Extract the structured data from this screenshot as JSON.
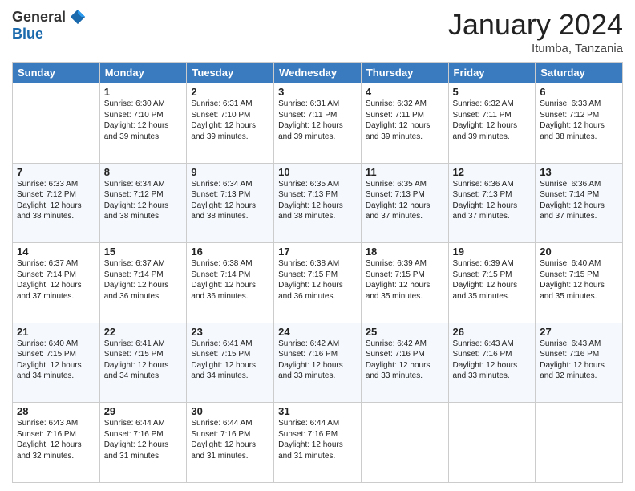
{
  "logo": {
    "general": "General",
    "blue": "Blue"
  },
  "title": "January 2024",
  "subtitle": "Itumba, Tanzania",
  "columns": [
    "Sunday",
    "Monday",
    "Tuesday",
    "Wednesday",
    "Thursday",
    "Friday",
    "Saturday"
  ],
  "weeks": [
    [
      {
        "day": "",
        "info": ""
      },
      {
        "day": "1",
        "info": "Sunrise: 6:30 AM\nSunset: 7:10 PM\nDaylight: 12 hours and 39 minutes."
      },
      {
        "day": "2",
        "info": "Sunrise: 6:31 AM\nSunset: 7:10 PM\nDaylight: 12 hours and 39 minutes."
      },
      {
        "day": "3",
        "info": "Sunrise: 6:31 AM\nSunset: 7:11 PM\nDaylight: 12 hours and 39 minutes."
      },
      {
        "day": "4",
        "info": "Sunrise: 6:32 AM\nSunset: 7:11 PM\nDaylight: 12 hours and 39 minutes."
      },
      {
        "day": "5",
        "info": "Sunrise: 6:32 AM\nSunset: 7:11 PM\nDaylight: 12 hours and 39 minutes."
      },
      {
        "day": "6",
        "info": "Sunrise: 6:33 AM\nSunset: 7:12 PM\nDaylight: 12 hours and 38 minutes."
      }
    ],
    [
      {
        "day": "7",
        "info": "Sunrise: 6:33 AM\nSunset: 7:12 PM\nDaylight: 12 hours and 38 minutes."
      },
      {
        "day": "8",
        "info": "Sunrise: 6:34 AM\nSunset: 7:12 PM\nDaylight: 12 hours and 38 minutes."
      },
      {
        "day": "9",
        "info": "Sunrise: 6:34 AM\nSunset: 7:13 PM\nDaylight: 12 hours and 38 minutes."
      },
      {
        "day": "10",
        "info": "Sunrise: 6:35 AM\nSunset: 7:13 PM\nDaylight: 12 hours and 38 minutes."
      },
      {
        "day": "11",
        "info": "Sunrise: 6:35 AM\nSunset: 7:13 PM\nDaylight: 12 hours and 37 minutes."
      },
      {
        "day": "12",
        "info": "Sunrise: 6:36 AM\nSunset: 7:13 PM\nDaylight: 12 hours and 37 minutes."
      },
      {
        "day": "13",
        "info": "Sunrise: 6:36 AM\nSunset: 7:14 PM\nDaylight: 12 hours and 37 minutes."
      }
    ],
    [
      {
        "day": "14",
        "info": "Sunrise: 6:37 AM\nSunset: 7:14 PM\nDaylight: 12 hours and 37 minutes."
      },
      {
        "day": "15",
        "info": "Sunrise: 6:37 AM\nSunset: 7:14 PM\nDaylight: 12 hours and 36 minutes."
      },
      {
        "day": "16",
        "info": "Sunrise: 6:38 AM\nSunset: 7:14 PM\nDaylight: 12 hours and 36 minutes."
      },
      {
        "day": "17",
        "info": "Sunrise: 6:38 AM\nSunset: 7:15 PM\nDaylight: 12 hours and 36 minutes."
      },
      {
        "day": "18",
        "info": "Sunrise: 6:39 AM\nSunset: 7:15 PM\nDaylight: 12 hours and 35 minutes."
      },
      {
        "day": "19",
        "info": "Sunrise: 6:39 AM\nSunset: 7:15 PM\nDaylight: 12 hours and 35 minutes."
      },
      {
        "day": "20",
        "info": "Sunrise: 6:40 AM\nSunset: 7:15 PM\nDaylight: 12 hours and 35 minutes."
      }
    ],
    [
      {
        "day": "21",
        "info": "Sunrise: 6:40 AM\nSunset: 7:15 PM\nDaylight: 12 hours and 34 minutes."
      },
      {
        "day": "22",
        "info": "Sunrise: 6:41 AM\nSunset: 7:15 PM\nDaylight: 12 hours and 34 minutes."
      },
      {
        "day": "23",
        "info": "Sunrise: 6:41 AM\nSunset: 7:15 PM\nDaylight: 12 hours and 34 minutes."
      },
      {
        "day": "24",
        "info": "Sunrise: 6:42 AM\nSunset: 7:16 PM\nDaylight: 12 hours and 33 minutes."
      },
      {
        "day": "25",
        "info": "Sunrise: 6:42 AM\nSunset: 7:16 PM\nDaylight: 12 hours and 33 minutes."
      },
      {
        "day": "26",
        "info": "Sunrise: 6:43 AM\nSunset: 7:16 PM\nDaylight: 12 hours and 33 minutes."
      },
      {
        "day": "27",
        "info": "Sunrise: 6:43 AM\nSunset: 7:16 PM\nDaylight: 12 hours and 32 minutes."
      }
    ],
    [
      {
        "day": "28",
        "info": "Sunrise: 6:43 AM\nSunset: 7:16 PM\nDaylight: 12 hours and 32 minutes."
      },
      {
        "day": "29",
        "info": "Sunrise: 6:44 AM\nSunset: 7:16 PM\nDaylight: 12 hours and 31 minutes."
      },
      {
        "day": "30",
        "info": "Sunrise: 6:44 AM\nSunset: 7:16 PM\nDaylight: 12 hours and 31 minutes."
      },
      {
        "day": "31",
        "info": "Sunrise: 6:44 AM\nSunset: 7:16 PM\nDaylight: 12 hours and 31 minutes."
      },
      {
        "day": "",
        "info": ""
      },
      {
        "day": "",
        "info": ""
      },
      {
        "day": "",
        "info": ""
      }
    ]
  ]
}
